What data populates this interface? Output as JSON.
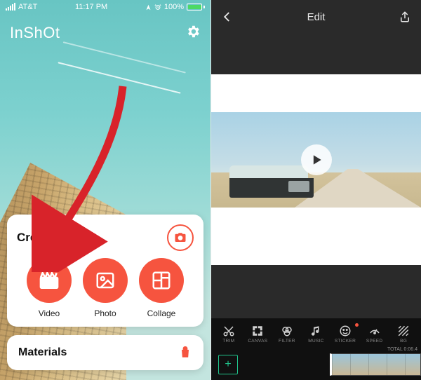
{
  "left": {
    "status": {
      "carrier": "AT&T",
      "time": "11:17 PM",
      "battery_pct": "100%"
    },
    "logo": "InShOt",
    "create": {
      "title": "Create New",
      "actions": [
        {
          "icon": "clapperboard-icon",
          "label": "Video"
        },
        {
          "icon": "picture-icon",
          "label": "Photo"
        },
        {
          "icon": "collage-icon",
          "label": "Collage"
        }
      ]
    },
    "materials": {
      "label": "Materials"
    }
  },
  "right": {
    "header": {
      "title": "Edit"
    },
    "toolbar": [
      {
        "icon": "cut-icon",
        "label": "TRIM"
      },
      {
        "icon": "canvas-icon",
        "label": "CANVAS"
      },
      {
        "icon": "filter-icon",
        "label": "FILTER"
      },
      {
        "icon": "music-icon",
        "label": "MUSIC"
      },
      {
        "icon": "sticker-icon",
        "label": "STICKER"
      },
      {
        "icon": "speed-icon",
        "label": "SPEED"
      },
      {
        "icon": "bg-icon",
        "label": "BG"
      }
    ],
    "timeline": {
      "total_label": "TOTAL 0:06.4"
    }
  },
  "colors": {
    "accent": "#f6543f",
    "dark": "#2a2a2a",
    "green": "#20c38b"
  }
}
